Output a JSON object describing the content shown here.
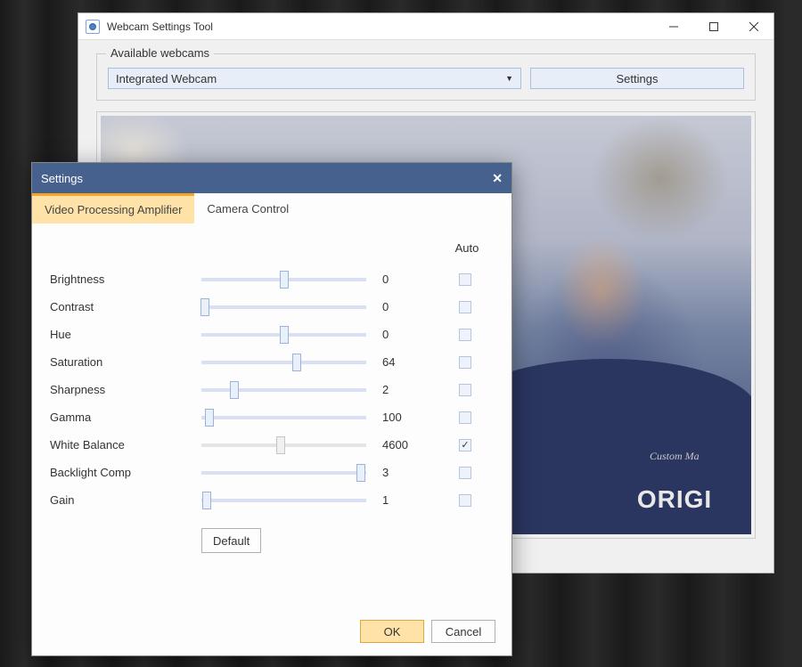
{
  "main_window": {
    "title": "Webcam Settings Tool",
    "fieldset_label": "Available webcams",
    "selected_webcam": "Integrated Webcam",
    "settings_button": "Settings"
  },
  "dialog": {
    "title": "Settings",
    "tabs": {
      "video_proc": "Video Processing Amplifier",
      "camera_ctrl": "Camera Control"
    },
    "auto_header": "Auto",
    "sliders": [
      {
        "label": "Brightness",
        "value": "0",
        "pos": 50,
        "auto": false,
        "disabled": false
      },
      {
        "label": "Contrast",
        "value": "0",
        "pos": 2,
        "auto": false,
        "disabled": false
      },
      {
        "label": "Hue",
        "value": "0",
        "pos": 50,
        "auto": false,
        "disabled": false
      },
      {
        "label": "Saturation",
        "value": "64",
        "pos": 58,
        "auto": false,
        "disabled": false
      },
      {
        "label": "Sharpness",
        "value": "2",
        "pos": 20,
        "auto": false,
        "disabled": false
      },
      {
        "label": "Gamma",
        "value": "100",
        "pos": 5,
        "auto": false,
        "disabled": false
      },
      {
        "label": "White Balance",
        "value": "4600",
        "pos": 48,
        "auto": true,
        "disabled": true
      },
      {
        "label": "Backlight Comp",
        "value": "3",
        "pos": 97,
        "auto": false,
        "disabled": false
      },
      {
        "label": "Gain",
        "value": "1",
        "pos": 3,
        "auto": false,
        "disabled": false
      }
    ],
    "default_button": "Default",
    "ok_button": "OK",
    "cancel_button": "Cancel"
  }
}
